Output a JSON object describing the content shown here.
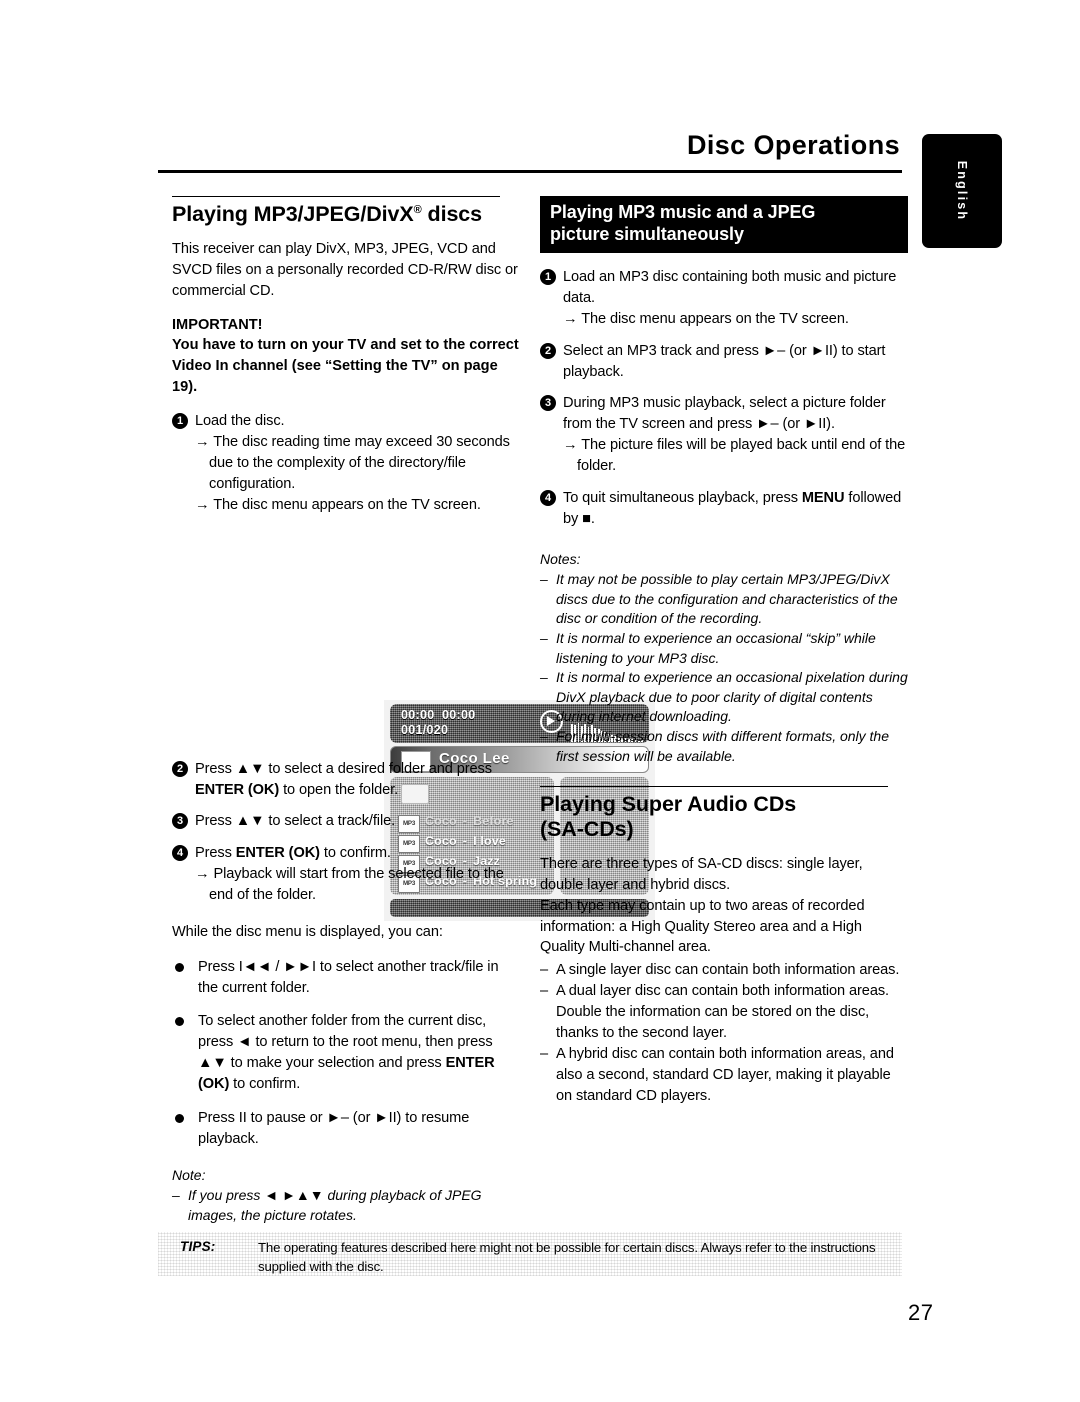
{
  "header": {
    "title": "Disc Operations",
    "language_tab": "English"
  },
  "left_column": {
    "heading": "Playing MP3/JPEG/DivX",
    "heading_sup": "®",
    "heading_tail": " discs",
    "intro": "This receiver can play DivX, MP3, JPEG, VCD and SVCD files on a personally recorded CD-R/RW disc or commercial CD.",
    "important_label": "IMPORTANT!",
    "important_text": "You have to turn on your TV and set to the correct Video In channel (see “Setting the TV” on page 19).",
    "steps": [
      {
        "num": "1",
        "text": "Load the disc.",
        "arrows": [
          "The disc reading time may exceed 30 seconds due to the complexity of the directory/file configuration.",
          "The disc menu appears on the TV screen."
        ]
      },
      {
        "num": "2",
        "text_pre": "Press ▲▼  to select a desired folder and press ",
        "text_bold": "ENTER (OK)",
        "text_post": " to open the folder.",
        "arrows": []
      },
      {
        "num": "3",
        "text": "Press ▲▼  to select a track/file.",
        "arrows": []
      },
      {
        "num": "4",
        "text_pre": "Press ",
        "text_bold": "ENTER (OK)",
        "text_post": " to confirm.",
        "arrows": [
          "Playback will start from the selected file to the end of the folder."
        ]
      }
    ],
    "while_line": "While the disc menu is displayed, you can:",
    "bullets": [
      {
        "parts": [
          {
            "t": "Press I◄◄ / ►►I to select another track/file in the current folder.",
            "bold": false
          }
        ]
      },
      {
        "parts": [
          {
            "t": "To select another folder from the current disc, press ◄ to return to the root menu, then press ▲▼ to make your selection and press ",
            "bold": false
          },
          {
            "t": "ENTER (OK)",
            "bold": true
          },
          {
            "t": " to confirm.",
            "bold": false
          }
        ]
      },
      {
        "parts": [
          {
            "t": "Press II to pause or ►– (or ►II) to resume playback.",
            "bold": false
          }
        ]
      }
    ],
    "note_title": "Note:",
    "notes": [
      "If you press ◄ ►▲▼ during playback of JPEG images, the picture rotates."
    ]
  },
  "disc_menu_screenshot": {
    "elapsed_time": "00:00",
    "total_time": "00:00",
    "track_counter": "001/020",
    "play_icon": "play-circle-icon",
    "equalizer_icon": "audio-level-meter-icon",
    "album_title": "Coco Lee",
    "tracks": [
      {
        "icon_label": "MP3",
        "artist": "Coco",
        "separator": "-",
        "title": "Before"
      },
      {
        "icon_label": "MP3",
        "artist": "Coco",
        "separator": "-",
        "title": "I love"
      },
      {
        "icon_label": "MP3",
        "artist": "Coco",
        "separator": "-",
        "title": "Jazz"
      },
      {
        "icon_label": "MP3",
        "artist": "Coco",
        "separator": "-",
        "title": "Hot spring"
      }
    ],
    "eq_bars": [
      18,
      17,
      19,
      16,
      18,
      15,
      17,
      14,
      13,
      11,
      10,
      8,
      7,
      6,
      5,
      4,
      4,
      3,
      3,
      2,
      2,
      2
    ]
  },
  "right_column": {
    "block_heading_line1": "Playing MP3 music and a JPEG",
    "block_heading_line2": "picture simultaneously",
    "steps": [
      {
        "num": "1",
        "text": "Load an MP3 disc containing both music and picture data.",
        "arrows": [
          "The disc menu appears on the TV screen."
        ]
      },
      {
        "num": "2",
        "text": "Select an MP3 track and press ►– (or ►II) to start playback.",
        "arrows": []
      },
      {
        "num": "3",
        "text": "During MP3 music playback, select a picture folder from the TV screen and press ►– (or ►II).",
        "arrows": [
          "The picture files will be played back until end of the folder."
        ]
      },
      {
        "num": "4",
        "text_pre": "To quit simultaneous playback, press ",
        "text_bold": "MENU",
        "text_post": " followed by ■.",
        "arrows": []
      }
    ],
    "notes_title": "Notes:",
    "notes": [
      "It may not be possible to play certain MP3/JPEG/DivX discs due to the configuration and characteristics of the disc or condition of the recording.",
      "It is normal to experience an occasional “skip” while listening to your MP3 disc.",
      "It is normal to experience an occasional pixelation during DivX playback due to poor clarity of digital contents during internet downloading.",
      "For multi-session discs with different formats, only the first session will be available."
    ],
    "sacd_heading_line1": "Playing Super Audio CDs",
    "sacd_heading_line2": "(SA-CDs)",
    "sacd_p1": "There are three types of SA-CD discs: single layer, double layer and hybrid discs.",
    "sacd_p2": "Each type may contain up to two areas of recorded information: a High Quality Stereo area and a High Quality Multi-channel area.",
    "sacd_items": [
      "A single layer disc can contain both information areas.",
      "A dual layer disc can contain both information areas. Double the information can be stored on the disc, thanks to the second layer.",
      "A hybrid disc can contain both information areas, and also a second, standard CD layer, making it playable on standard CD players."
    ]
  },
  "footer": {
    "tips_label": "TIPS:",
    "tips_text": "The operating features described here might not be possible for certain discs. Always refer to the instructions supplied with the disc.",
    "page_number": "27"
  }
}
